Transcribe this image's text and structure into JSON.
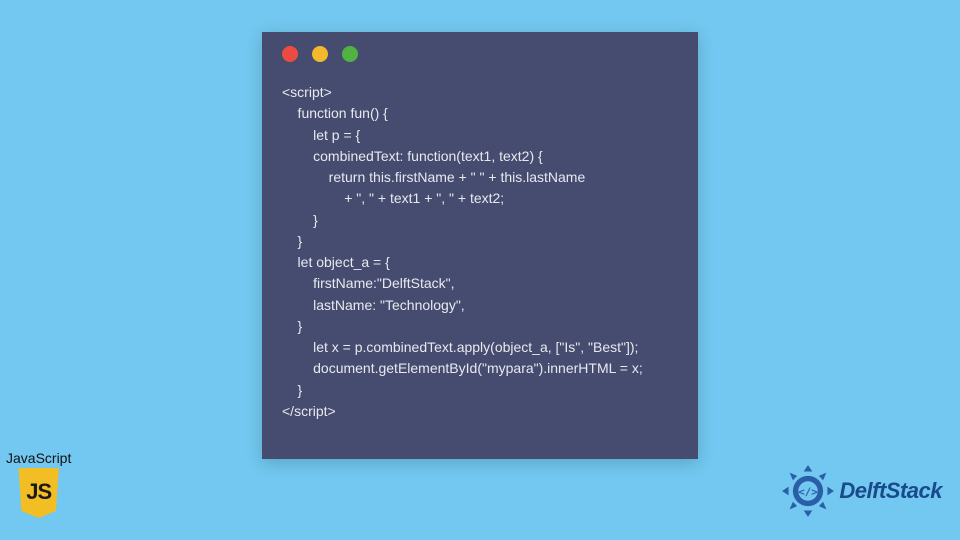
{
  "window": {
    "dots": [
      "red",
      "yellow",
      "green"
    ]
  },
  "code": {
    "lines": [
      "<script>",
      "    function fun() {",
      "        let p = {",
      "        combinedText: function(text1, text2) {",
      "            return this.firstName + \" \" + this.lastName",
      "                + \", \" + text1 + \", \" + text2;",
      "        }",
      "    }",
      "    let object_a = {",
      "        firstName:\"DelftStack\",",
      "        lastName: \"Technology\",",
      "    }",
      "        let x = p.combinedText.apply(object_a, [\"Is\", \"Best\"]);",
      "        document.getElementById(\"mypara\").innerHTML = x;",
      "    }",
      "</script>"
    ]
  },
  "badge": {
    "label": "JavaScript",
    "shield_text": "JS"
  },
  "brand": {
    "name": "DelftStack",
    "accent": "#2a5fa8"
  }
}
